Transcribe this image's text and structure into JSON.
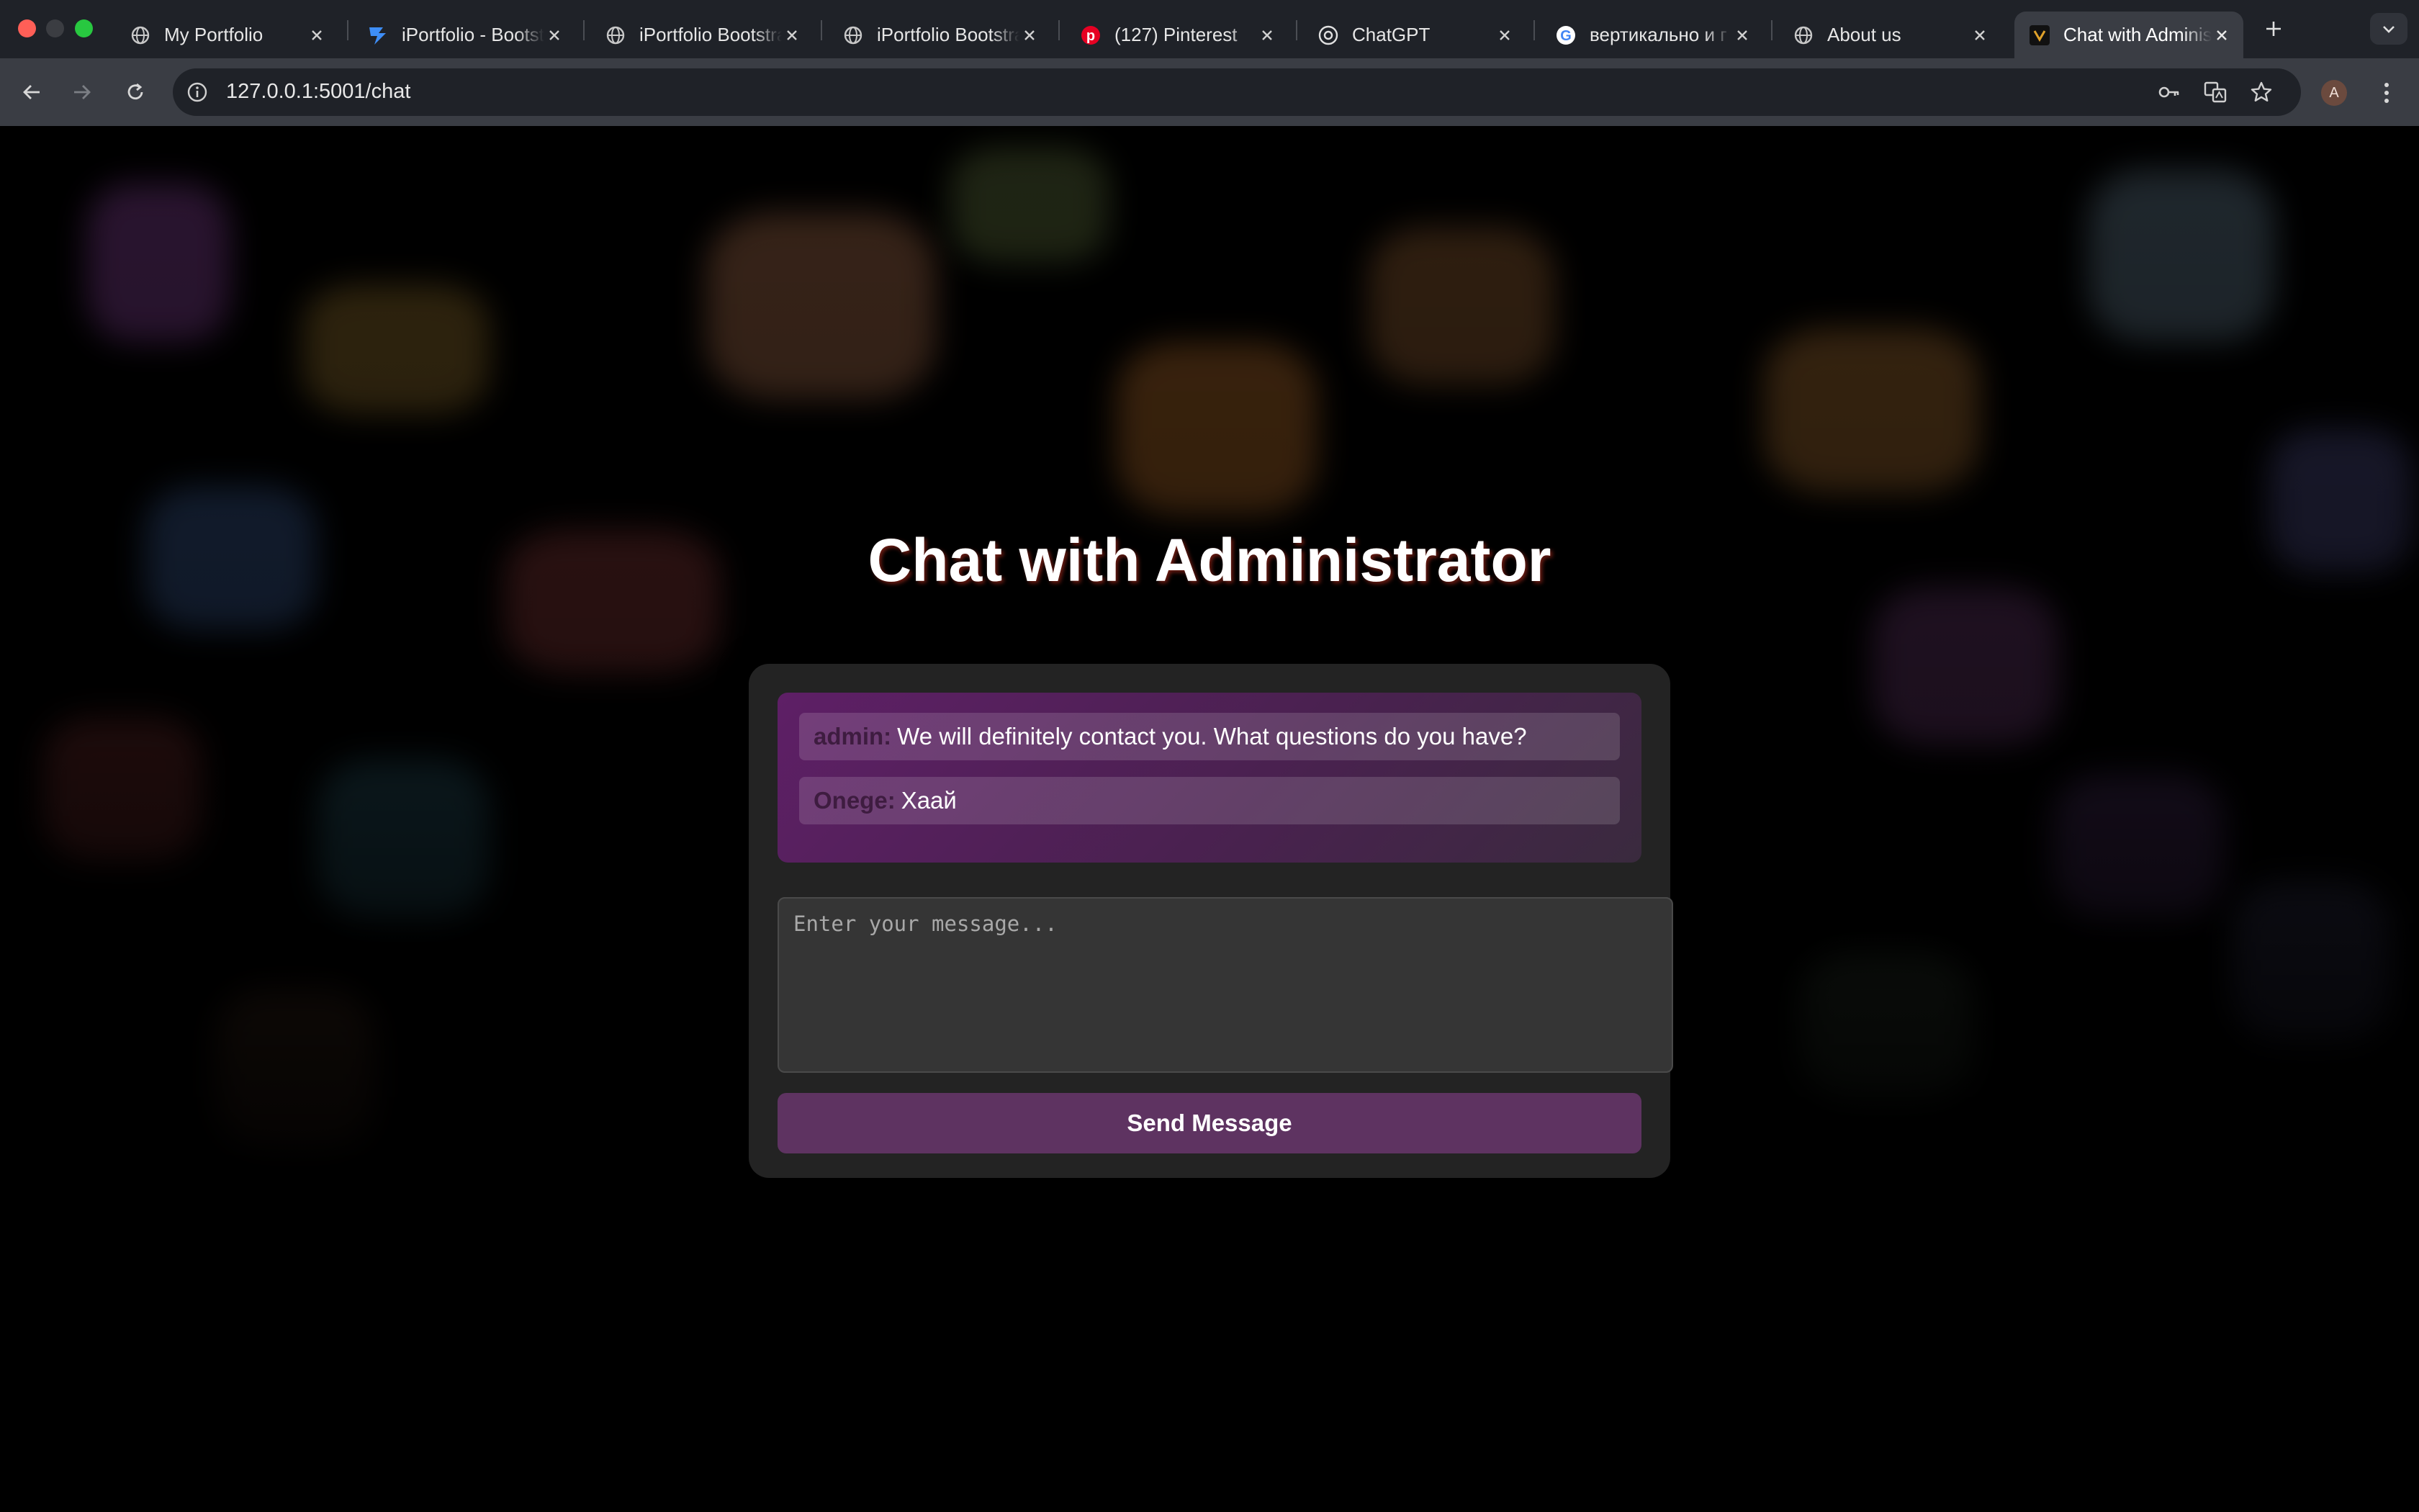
{
  "browser": {
    "tabs": [
      {
        "title": "My Portfolio",
        "favicon": "globe-icon"
      },
      {
        "title": "iPortfolio - Bootstrap",
        "favicon": "bootstrapmade-logo-icon"
      },
      {
        "title": "iPortfolio Bootstrap",
        "favicon": "globe-icon"
      },
      {
        "title": "iPortfolio Bootstrap",
        "favicon": "globe-icon"
      },
      {
        "title": "(127) Pinterest",
        "favicon": "pinterest-icon"
      },
      {
        "title": "ChatGPT",
        "favicon": "chatgpt-icon"
      },
      {
        "title": "вертикально и г",
        "favicon": "google-icon"
      },
      {
        "title": "About us",
        "favicon": "globe-icon"
      },
      {
        "title": "Chat with Administrator",
        "favicon": "site-logo-icon",
        "active": true
      }
    ],
    "url": "127.0.0.1:5001/chat",
    "profile_initial": "A"
  },
  "page": {
    "title": "Chat with Administrator",
    "messages": [
      {
        "sender": "admin:",
        "text": "We will definitely contact you. What questions do you have?"
      },
      {
        "sender": "Onege:",
        "text": "Хаай"
      }
    ],
    "input_placeholder": "Enter your message...",
    "send_label": "Send Message"
  },
  "colors": {
    "accent": "#5e3361",
    "messages_gradient_start": "#5e1f66",
    "card_background": "#232323"
  }
}
